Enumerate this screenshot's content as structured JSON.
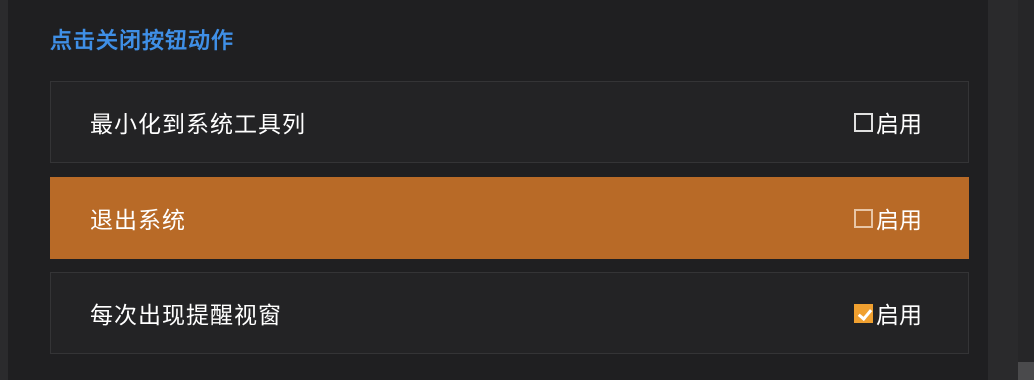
{
  "section": {
    "title": "点击关闭按钮动作"
  },
  "options": [
    {
      "label": "最小化到系统工具列",
      "enable_label": "启用",
      "checked": false,
      "highlighted": false
    },
    {
      "label": "退出系统",
      "enable_label": "启用",
      "checked": false,
      "highlighted": true
    },
    {
      "label": "每次出现提醒视窗",
      "enable_label": "启用",
      "checked": true,
      "highlighted": false
    }
  ],
  "colors": {
    "title": "#3f8fe6",
    "highlight": "#b86a27",
    "checkbox_checked": "#f0a030",
    "row_background": "#232325"
  }
}
